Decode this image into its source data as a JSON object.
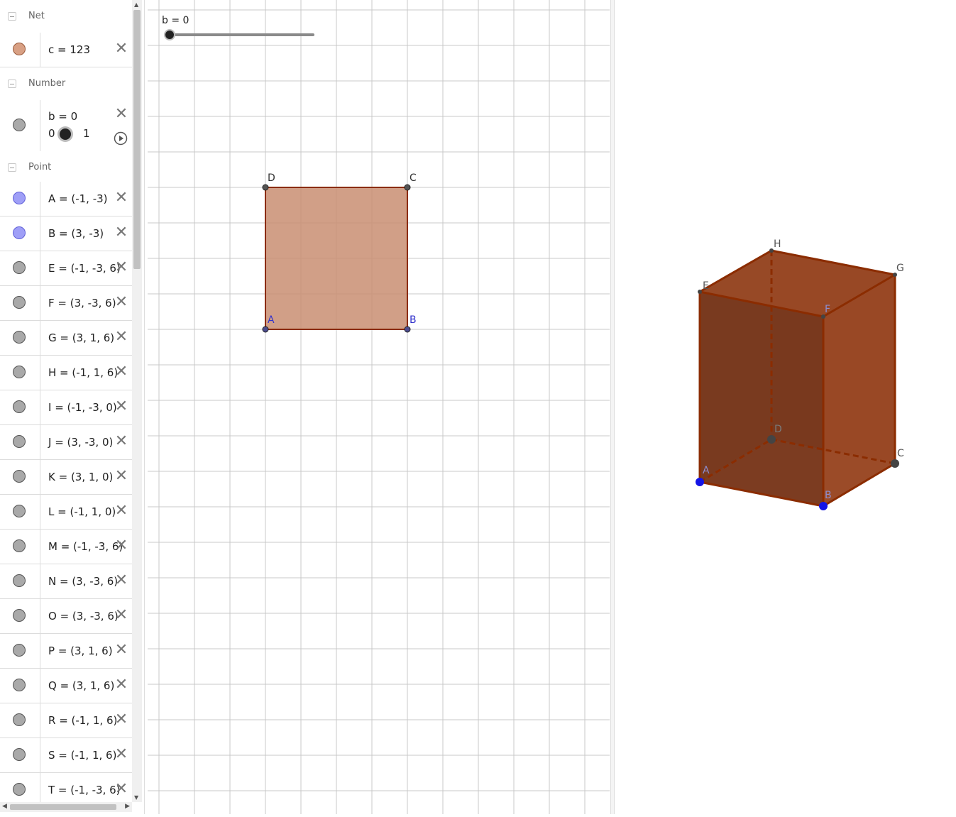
{
  "algebra": {
    "groups": [
      {
        "label": "Net"
      },
      {
        "label": "Number"
      },
      {
        "label": "Point"
      }
    ],
    "net_item": {
      "expr": "c = 123",
      "color": "#d8a084"
    },
    "number_item": {
      "expr": "b = 0",
      "min": "0",
      "max": "1",
      "value": 0
    },
    "points": [
      {
        "expr": "A = (-1, -3)",
        "color": "blue"
      },
      {
        "expr": "B = (3, -3)",
        "color": "blue"
      },
      {
        "expr": "E = (-1, -3, 6)",
        "color": "gray"
      },
      {
        "expr": "F = (3, -3, 6)",
        "color": "gray"
      },
      {
        "expr": "G = (3, 1, 6)",
        "color": "gray"
      },
      {
        "expr": "H = (-1, 1, 6)",
        "color": "gray"
      },
      {
        "expr": "I = (-1, -3, 0)",
        "color": "gray"
      },
      {
        "expr": "J = (3, -3, 0)",
        "color": "gray"
      },
      {
        "expr": "K = (3, 1, 0)",
        "color": "gray"
      },
      {
        "expr": "L = (-1, 1, 0)",
        "color": "gray"
      },
      {
        "expr": "M = (-1, -3, 6)",
        "color": "gray"
      },
      {
        "expr": "N = (3, -3, 6)",
        "color": "gray"
      },
      {
        "expr": "O = (3, -3, 6)",
        "color": "gray"
      },
      {
        "expr": "P = (3, 1, 6)",
        "color": "gray"
      },
      {
        "expr": "Q = (3, 1, 6)",
        "color": "gray"
      },
      {
        "expr": "R = (-1, 1, 6)",
        "color": "gray"
      },
      {
        "expr": "S = (-1, 1, 6)",
        "color": "gray"
      },
      {
        "expr": "T = (-1, -3, 6)",
        "color": "gray"
      }
    ]
  },
  "graphics": {
    "slider_label": "b = 0",
    "slider_value": 0,
    "square_labels": {
      "A": "A",
      "B": "B",
      "C": "C",
      "D": "D"
    },
    "fill_color": "#c98e72",
    "edge_color": "#8b2c00"
  },
  "view3d": {
    "labels": {
      "A": "A",
      "B": "B",
      "C": "C",
      "D": "D",
      "E": "E",
      "F": "F",
      "G": "G",
      "H": "H"
    },
    "face_color": "#8b3a12",
    "edge_color": "#8b2c00"
  }
}
